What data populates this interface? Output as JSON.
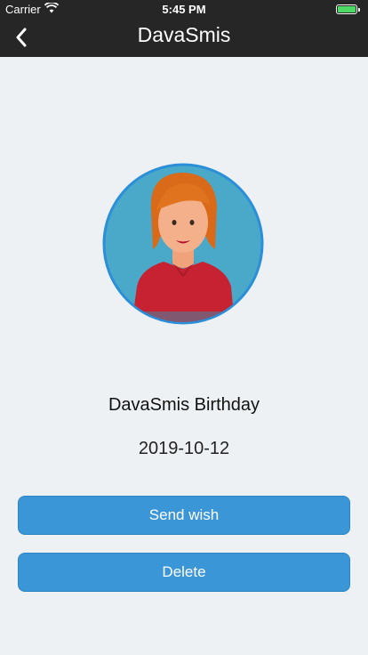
{
  "status_bar": {
    "carrier": "Carrier",
    "time": "5:45 PM",
    "wifi_icon": "wifi-icon",
    "battery_icon": "battery-icon",
    "battery_color": "#4cd964"
  },
  "nav": {
    "title": "DavaSmis",
    "back_icon": "chevron-left-icon"
  },
  "profile": {
    "avatar_icon": "person-avatar",
    "name_label": "DavaSmis Birthday",
    "date": "2019-10-12"
  },
  "actions": {
    "send_label": "Send wish",
    "delete_label": "Delete",
    "button_color": "#3b96d8"
  }
}
